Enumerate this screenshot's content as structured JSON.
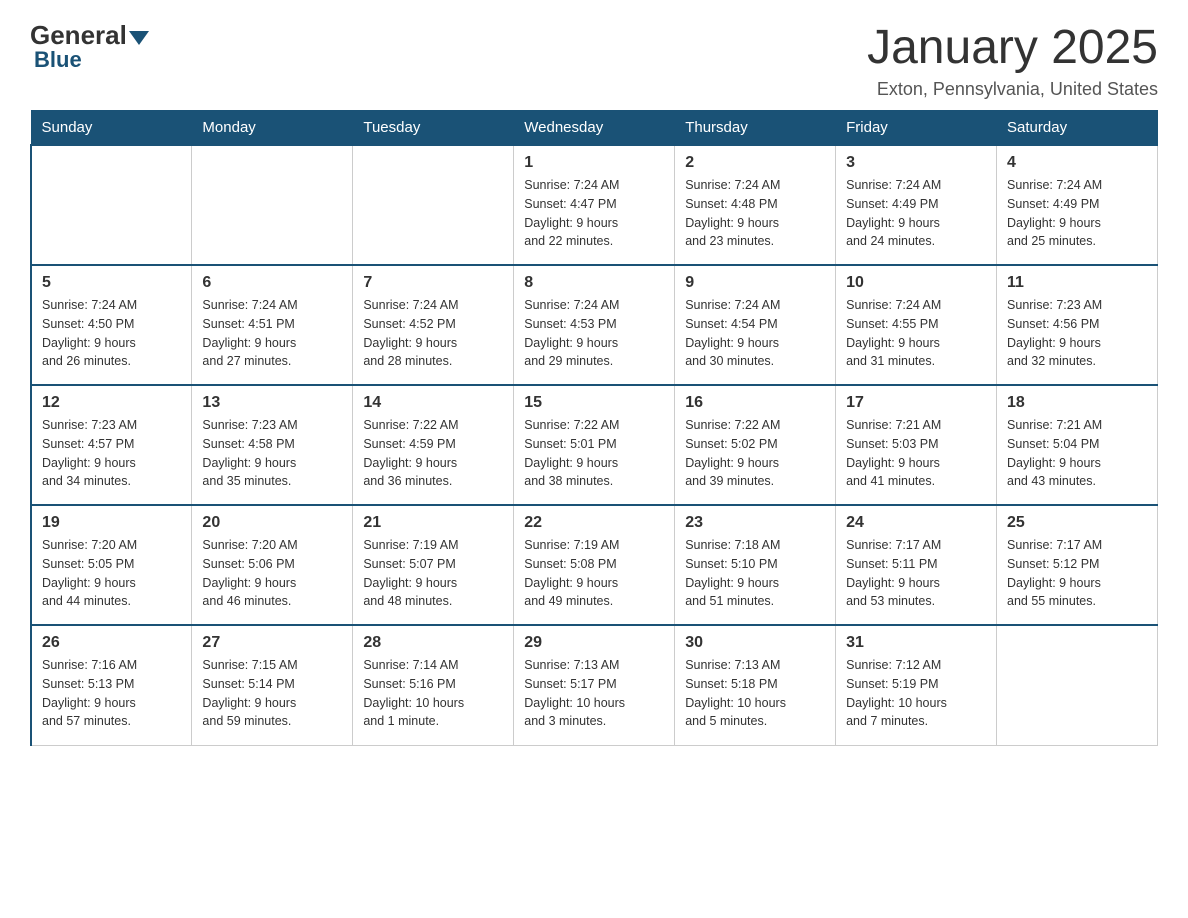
{
  "header": {
    "logo_general": "General",
    "logo_blue": "Blue",
    "month_title": "January 2025",
    "location": "Exton, Pennsylvania, United States"
  },
  "days_of_week": [
    "Sunday",
    "Monday",
    "Tuesday",
    "Wednesday",
    "Thursday",
    "Friday",
    "Saturday"
  ],
  "weeks": [
    [
      {
        "day": "",
        "info": ""
      },
      {
        "day": "",
        "info": ""
      },
      {
        "day": "",
        "info": ""
      },
      {
        "day": "1",
        "info": "Sunrise: 7:24 AM\nSunset: 4:47 PM\nDaylight: 9 hours\nand 22 minutes."
      },
      {
        "day": "2",
        "info": "Sunrise: 7:24 AM\nSunset: 4:48 PM\nDaylight: 9 hours\nand 23 minutes."
      },
      {
        "day": "3",
        "info": "Sunrise: 7:24 AM\nSunset: 4:49 PM\nDaylight: 9 hours\nand 24 minutes."
      },
      {
        "day": "4",
        "info": "Sunrise: 7:24 AM\nSunset: 4:49 PM\nDaylight: 9 hours\nand 25 minutes."
      }
    ],
    [
      {
        "day": "5",
        "info": "Sunrise: 7:24 AM\nSunset: 4:50 PM\nDaylight: 9 hours\nand 26 minutes."
      },
      {
        "day": "6",
        "info": "Sunrise: 7:24 AM\nSunset: 4:51 PM\nDaylight: 9 hours\nand 27 minutes."
      },
      {
        "day": "7",
        "info": "Sunrise: 7:24 AM\nSunset: 4:52 PM\nDaylight: 9 hours\nand 28 minutes."
      },
      {
        "day": "8",
        "info": "Sunrise: 7:24 AM\nSunset: 4:53 PM\nDaylight: 9 hours\nand 29 minutes."
      },
      {
        "day": "9",
        "info": "Sunrise: 7:24 AM\nSunset: 4:54 PM\nDaylight: 9 hours\nand 30 minutes."
      },
      {
        "day": "10",
        "info": "Sunrise: 7:24 AM\nSunset: 4:55 PM\nDaylight: 9 hours\nand 31 minutes."
      },
      {
        "day": "11",
        "info": "Sunrise: 7:23 AM\nSunset: 4:56 PM\nDaylight: 9 hours\nand 32 minutes."
      }
    ],
    [
      {
        "day": "12",
        "info": "Sunrise: 7:23 AM\nSunset: 4:57 PM\nDaylight: 9 hours\nand 34 minutes."
      },
      {
        "day": "13",
        "info": "Sunrise: 7:23 AM\nSunset: 4:58 PM\nDaylight: 9 hours\nand 35 minutes."
      },
      {
        "day": "14",
        "info": "Sunrise: 7:22 AM\nSunset: 4:59 PM\nDaylight: 9 hours\nand 36 minutes."
      },
      {
        "day": "15",
        "info": "Sunrise: 7:22 AM\nSunset: 5:01 PM\nDaylight: 9 hours\nand 38 minutes."
      },
      {
        "day": "16",
        "info": "Sunrise: 7:22 AM\nSunset: 5:02 PM\nDaylight: 9 hours\nand 39 minutes."
      },
      {
        "day": "17",
        "info": "Sunrise: 7:21 AM\nSunset: 5:03 PM\nDaylight: 9 hours\nand 41 minutes."
      },
      {
        "day": "18",
        "info": "Sunrise: 7:21 AM\nSunset: 5:04 PM\nDaylight: 9 hours\nand 43 minutes."
      }
    ],
    [
      {
        "day": "19",
        "info": "Sunrise: 7:20 AM\nSunset: 5:05 PM\nDaylight: 9 hours\nand 44 minutes."
      },
      {
        "day": "20",
        "info": "Sunrise: 7:20 AM\nSunset: 5:06 PM\nDaylight: 9 hours\nand 46 minutes."
      },
      {
        "day": "21",
        "info": "Sunrise: 7:19 AM\nSunset: 5:07 PM\nDaylight: 9 hours\nand 48 minutes."
      },
      {
        "day": "22",
        "info": "Sunrise: 7:19 AM\nSunset: 5:08 PM\nDaylight: 9 hours\nand 49 minutes."
      },
      {
        "day": "23",
        "info": "Sunrise: 7:18 AM\nSunset: 5:10 PM\nDaylight: 9 hours\nand 51 minutes."
      },
      {
        "day": "24",
        "info": "Sunrise: 7:17 AM\nSunset: 5:11 PM\nDaylight: 9 hours\nand 53 minutes."
      },
      {
        "day": "25",
        "info": "Sunrise: 7:17 AM\nSunset: 5:12 PM\nDaylight: 9 hours\nand 55 minutes."
      }
    ],
    [
      {
        "day": "26",
        "info": "Sunrise: 7:16 AM\nSunset: 5:13 PM\nDaylight: 9 hours\nand 57 minutes."
      },
      {
        "day": "27",
        "info": "Sunrise: 7:15 AM\nSunset: 5:14 PM\nDaylight: 9 hours\nand 59 minutes."
      },
      {
        "day": "28",
        "info": "Sunrise: 7:14 AM\nSunset: 5:16 PM\nDaylight: 10 hours\nand 1 minute."
      },
      {
        "day": "29",
        "info": "Sunrise: 7:13 AM\nSunset: 5:17 PM\nDaylight: 10 hours\nand 3 minutes."
      },
      {
        "day": "30",
        "info": "Sunrise: 7:13 AM\nSunset: 5:18 PM\nDaylight: 10 hours\nand 5 minutes."
      },
      {
        "day": "31",
        "info": "Sunrise: 7:12 AM\nSunset: 5:19 PM\nDaylight: 10 hours\nand 7 minutes."
      },
      {
        "day": "",
        "info": ""
      }
    ]
  ]
}
